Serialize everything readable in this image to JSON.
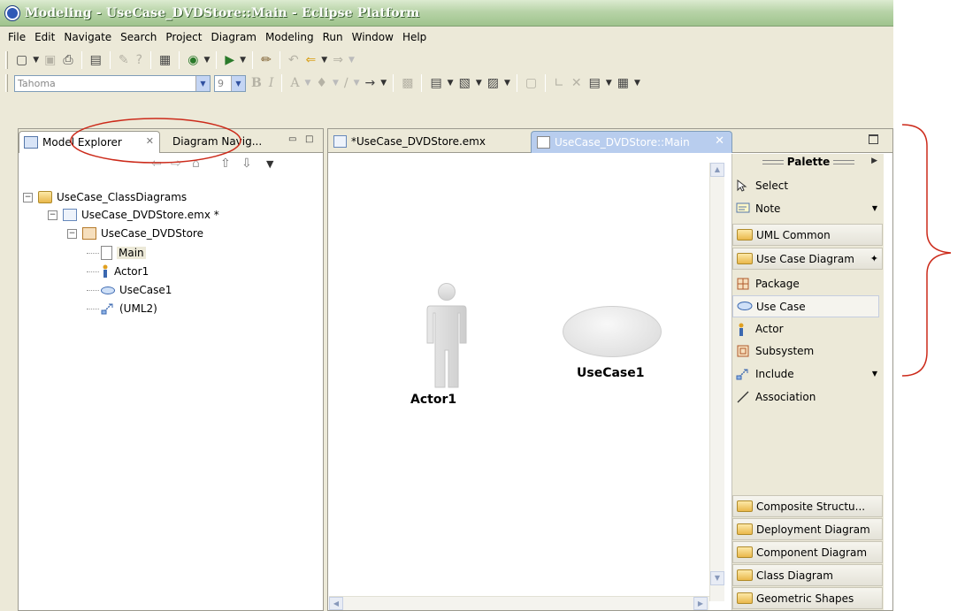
{
  "window": {
    "title": "Modeling - UseCase_DVDStore::Main - Eclipse Platform"
  },
  "menu": [
    "File",
    "Edit",
    "Navigate",
    "Search",
    "Project",
    "Diagram",
    "Modeling",
    "Run",
    "Window",
    "Help"
  ],
  "toolbar": {
    "font_name": "Tahoma",
    "font_size": "9"
  },
  "left_panel": {
    "tab_active": "Model Explorer",
    "tab_other": "Diagram Navig...",
    "tree": [
      {
        "label": "UseCase_ClassDiagrams",
        "icon": "folder-icon"
      },
      {
        "label": "UseCase_DVDStore.emx *",
        "icon": "emx-file-icon"
      },
      {
        "label": "UseCase_DVDStore",
        "icon": "package-icon"
      },
      {
        "label": "Main",
        "icon": "diagram-page-icon",
        "selected": true
      },
      {
        "label": "Actor1",
        "icon": "actor-icon"
      },
      {
        "label": "UseCase1",
        "icon": "usecase-icon"
      },
      {
        "label": "(UML2)",
        "icon": "profile-icon"
      }
    ]
  },
  "editor": {
    "tab1": "*UseCase_DVDStore.emx",
    "tab2": "UseCase_DVDStore::Main",
    "actor_label": "Actor1",
    "usecase_label": "UseCase1"
  },
  "palette": {
    "title": "Palette",
    "items_top": [
      {
        "label": "Select",
        "icon": "cursor-arrow-icon"
      },
      {
        "label": "Note",
        "icon": "note-icon"
      }
    ],
    "drawers": [
      "UML Common",
      "Use Case Diagram"
    ],
    "usecase_tools": [
      {
        "label": "Package",
        "icon": "package-icon"
      },
      {
        "label": "Use Case",
        "icon": "usecase-icon"
      },
      {
        "label": "Actor",
        "icon": "actor-icon"
      },
      {
        "label": "Subsystem",
        "icon": "subsystem-icon"
      },
      {
        "label": "Include",
        "icon": "include-icon"
      },
      {
        "label": "Association",
        "icon": "association-line-icon"
      }
    ],
    "bottom_drawers": [
      "Composite Structu...",
      "Deployment Diagram",
      "Component Diagram",
      "Class Diagram",
      "Geometric Shapes"
    ]
  },
  "colors": {
    "annotation_red": "#cc2a1a",
    "active_tab_blue": "#b8cdee",
    "title_green": "#9fc48d"
  }
}
